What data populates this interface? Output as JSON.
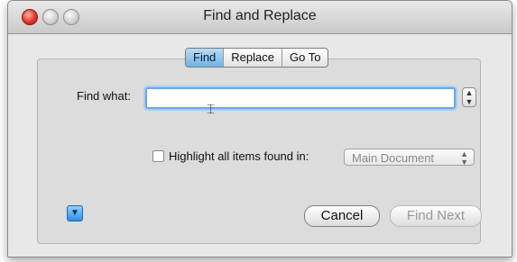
{
  "window": {
    "title": "Find and Replace"
  },
  "tabs": [
    {
      "label": "Find",
      "active": true
    },
    {
      "label": "Replace",
      "active": false
    },
    {
      "label": "Go To",
      "active": false
    }
  ],
  "find": {
    "label": "Find what:",
    "value": ""
  },
  "highlight": {
    "label": "Highlight all items found in:",
    "checked": false,
    "scope_value": "Main Document"
  },
  "buttons": {
    "cancel": "Cancel",
    "find_next": "Find Next"
  },
  "colors": {
    "accent": "#6aa7e6",
    "active_tab": "#6fb1e6",
    "close_button": "#e2362a"
  }
}
